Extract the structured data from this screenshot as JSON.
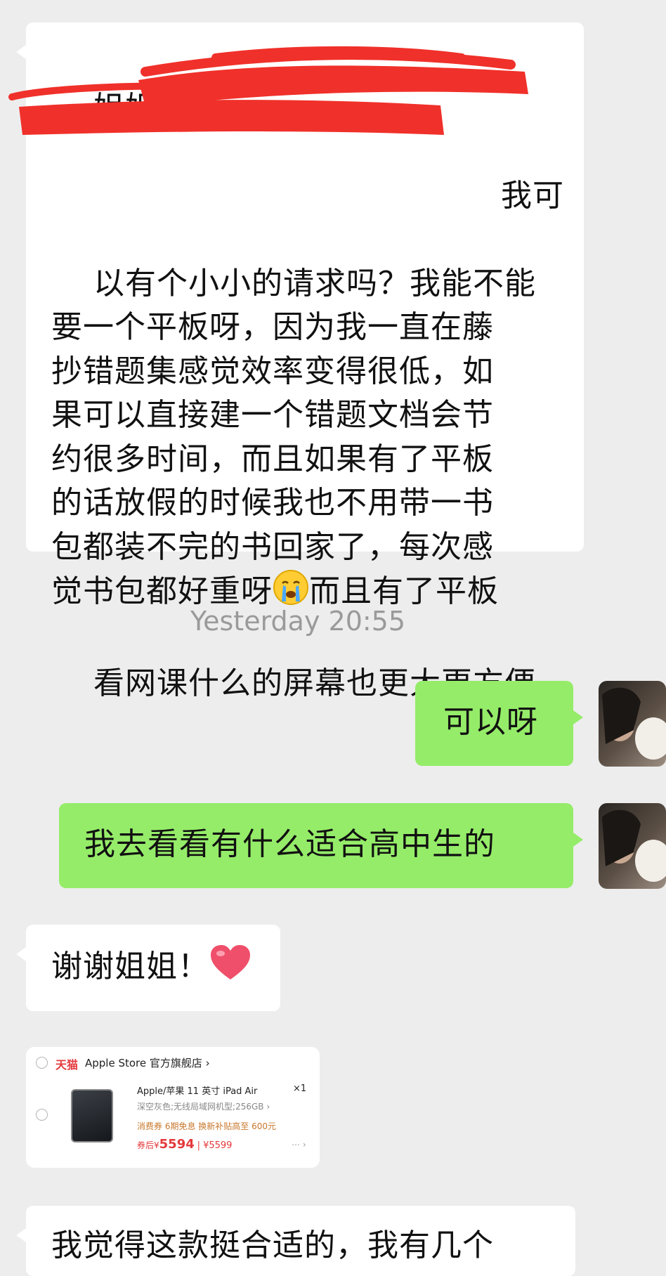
{
  "messages": {
    "m1": {
      "line1": "姐姐，",
      "line2_visible": "我可",
      "rest": "以有个小小的请求吗？我能不能\n要一个平板呀，因为我一直在藤\n抄错题集感觉效率变得很低，如\n果可以直接建一个错题文档会节\n约很多时间，而且如果有了平板\n的话放假的时候我也不用带一书\n包都装不完的书回家了，每次感\n觉书包都好重呀",
      "after_emoji": "而且有了平板",
      "last": "看网课什么的屏幕也更大更方便",
      "emoji": "crying-face"
    },
    "timestamp": "Yesterday 20:55",
    "m2": "可以呀",
    "m3": "我去看看有什么适合高中生的",
    "m4": "谢谢姐姐！",
    "m4_emoji": "heart",
    "m6": "我觉得这款挺合适的，我有几个"
  },
  "card": {
    "shop_logo": "天猫",
    "shop_name": "Apple Store 官方旗舰店 ›",
    "title": "Apple/苹果 11 英寸 iPad Air",
    "qty": "×1",
    "spec": "深空灰色;无线局域网机型;256GB ›",
    "tags": "消费券    6期免息    换新补贴高至 600元",
    "price_prefix": "券后¥",
    "price": "5594",
    "price_orig": "| ¥5599",
    "more": "⋯ ›"
  },
  "colors": {
    "bg": "#ededed",
    "bubble_in": "#ffffff",
    "bubble_out": "#95ec69",
    "redaction": "#f0302a"
  }
}
